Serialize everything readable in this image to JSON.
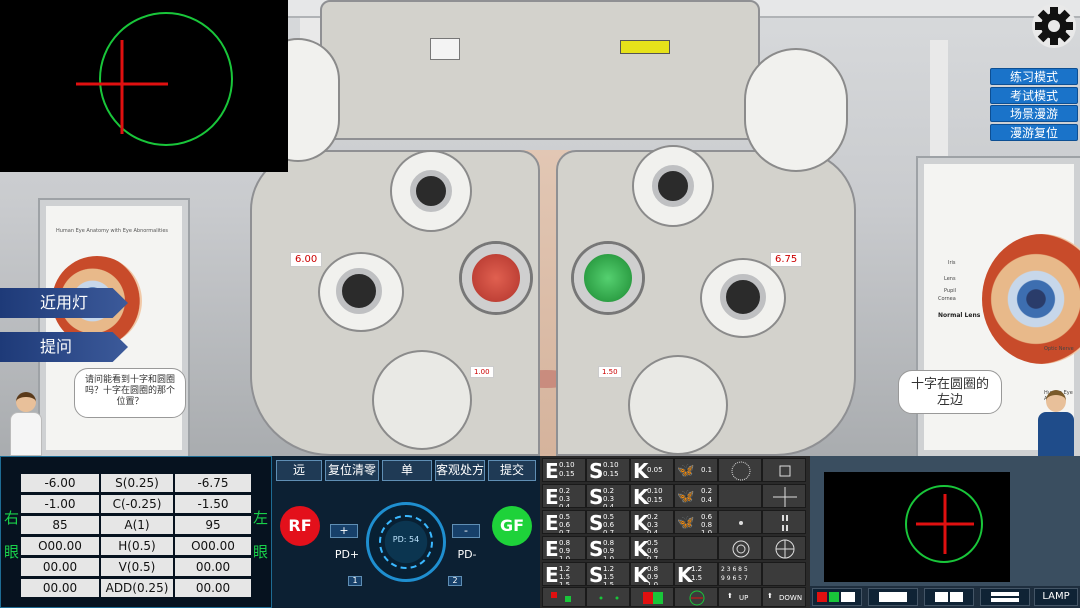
{
  "scene": {
    "left_lens_value": "6.00",
    "right_lens_value": "6.75",
    "left_axis_value": "1.00",
    "right_axis_value": "1.50",
    "poster_left_title": "Human Eye Anatomy with Eye Abnormalities",
    "poster_right_labels": [
      "Iris",
      "Lens",
      "Pupil",
      "Cornea",
      "Normal Lens",
      "Optic Nerve",
      "Human Eye Anat"
    ]
  },
  "mode_menu": [
    "练习模式",
    "考试模式",
    "场景漫游",
    "漫游复位"
  ],
  "side_menu": {
    "near_light": "近用灯",
    "ask": "提问"
  },
  "doctor_bubble": "请问能看到十字和圆圈吗？十字在圆圈的那个位置？",
  "patient_bubble": "十字在圆圈的左边",
  "left_panel": {
    "right_eye_label": [
      "右",
      "眼"
    ],
    "left_eye_label": [
      "左",
      "眼"
    ],
    "rows": [
      {
        "r": "-6.00",
        "label": "S(0.25)",
        "l": "-6.75"
      },
      {
        "r": "-1.00",
        "label": "C(-0.25)",
        "l": "-1.50"
      },
      {
        "r": "85",
        "label": "A(1)",
        "l": "95"
      },
      {
        "r": "O00.00",
        "label": "H(0.5)",
        "l": "O00.00"
      },
      {
        "r": "00.00",
        "label": "V(0.5)",
        "l": "00.00"
      },
      {
        "r": "00.00",
        "label": "ADD(0.25)",
        "l": "00.00"
      }
    ]
  },
  "mid_panel": {
    "tabs": [
      "远",
      "复位清零",
      "单",
      "客观处方",
      "提交"
    ],
    "rf": "RF",
    "gf": "GF",
    "plus": "+",
    "minus": "-",
    "pd_plus": "PD+",
    "pd_minus": "PD-",
    "pd_label": "PD: 54",
    "one": "1",
    "two": "2"
  },
  "chart_panel": {
    "rows": [
      [
        {
          "big": "E",
          "a": "0.10",
          "b": "0.15"
        },
        {
          "big": "S",
          "a": "0.10",
          "b": "0.15"
        },
        {
          "big": "K",
          "a": "0.05",
          "b": ""
        },
        {
          "big": "",
          "a": "0.1",
          "b": ""
        }
      ],
      [
        {
          "big": "E",
          "a": "0.2",
          "b": "0.3\n0.4"
        },
        {
          "big": "S",
          "a": "0.2",
          "b": "0.3\n0.4"
        },
        {
          "big": "K",
          "a": "0.10",
          "b": "0.15"
        },
        {
          "big": "",
          "a": "0.2",
          "b": "0.4"
        }
      ],
      [
        {
          "big": "E",
          "a": "0.5",
          "b": "0.6\n0.7"
        },
        {
          "big": "S",
          "a": "0.5",
          "b": "0.6\n0.7"
        },
        {
          "big": "K",
          "a": "0.2",
          "b": "0.3\n0.4"
        },
        {
          "big": "",
          "a": "0.6",
          "b": "0.8\n1.0"
        }
      ],
      [
        {
          "big": "E",
          "a": "0.8",
          "b": "0.9\n1.0"
        },
        {
          "big": "S",
          "a": "0.8",
          "b": "0.9\n1.0"
        },
        {
          "big": "K",
          "a": "0.5",
          "b": "0.6\n0.7"
        },
        {
          "big": "",
          "a": "",
          "b": ""
        }
      ],
      [
        {
          "big": "E",
          "a": "1.2",
          "b": "1.5\n1.5"
        },
        {
          "big": "S",
          "a": "1.2",
          "b": "1.5\n1.5"
        },
        {
          "big": "K",
          "a": "0.8",
          "b": "0.9\n1.0"
        },
        {
          "big": "K",
          "a": "1.2",
          "b": "1.5"
        }
      ]
    ],
    "num_row_a": "2 3 6 8 5",
    "num_row_b": "9 9 6 5 7",
    "up": "UP",
    "down": "DOWN"
  },
  "bottom_bar": {
    "lamp": "LAMP"
  },
  "colors": {
    "scope_circle": "#19c63a",
    "cross": "#e01010",
    "rf": "#e3101b",
    "gf": "#1ed23a",
    "mode_btn": "#1a73c9"
  }
}
